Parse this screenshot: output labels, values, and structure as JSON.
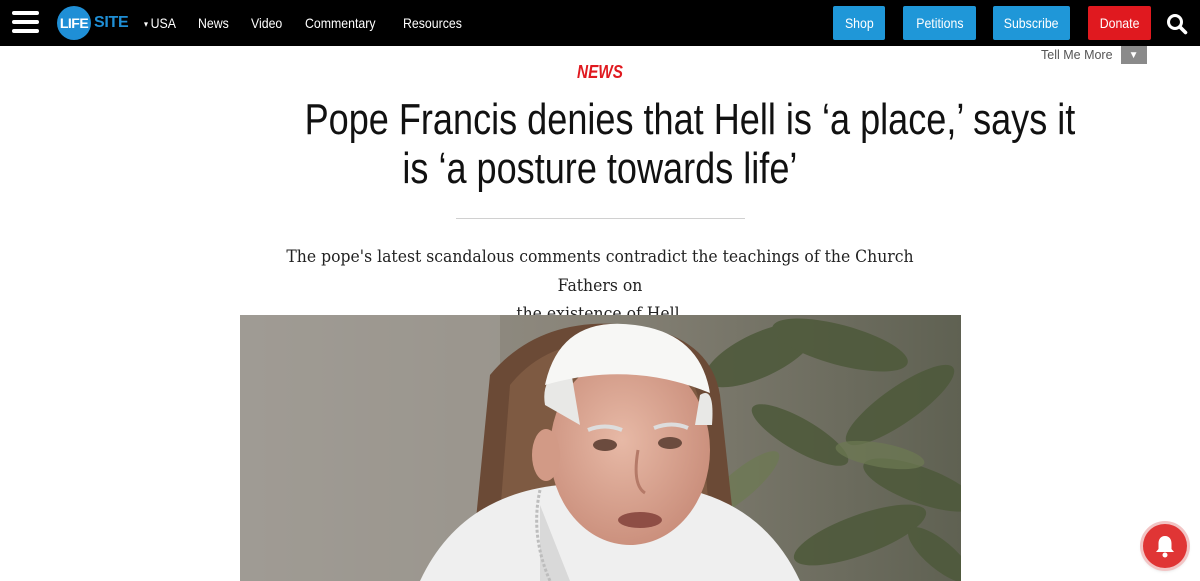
{
  "brand": {
    "logo_part1": "LIFE",
    "logo_part2": "SITE"
  },
  "nav": {
    "items": [
      {
        "label": "USA",
        "caret": "▾"
      },
      {
        "label": "News"
      },
      {
        "label": "Video"
      },
      {
        "label": "Commentary"
      },
      {
        "label": "Resources"
      }
    ]
  },
  "header_buttons": {
    "shop": "Shop",
    "petitions": "Petitions",
    "subscribe": "Subscribe",
    "donate": "Donate"
  },
  "tell_me_more": {
    "label": "Tell Me More",
    "arrow": "▼"
  },
  "article": {
    "category": "NEWS",
    "headline_line1": "Pope Francis denies that Hell is ‘a place,’ says it",
    "headline_line2": "is ‘a posture towards life’",
    "subtitle_line1": "The pope's latest scandalous comments contradict the teachings of the Church Fathers on",
    "subtitle_line2": "the existence of Hell."
  },
  "colors": {
    "topbar": "#000000",
    "brand_blue": "#1f97d8",
    "donate_red": "#e0191f",
    "category_red": "#e0191f",
    "bell_red": "#e03535"
  },
  "icons": {
    "menu": "hamburger-menu-icon",
    "search": "search-icon",
    "notification": "bell-icon"
  }
}
